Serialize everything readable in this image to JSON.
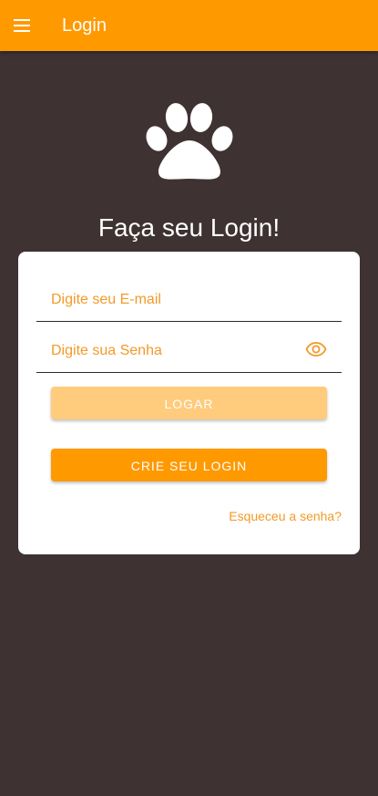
{
  "appbar": {
    "title": "Login",
    "menu_icon": "menu-icon",
    "background": "#ff9900"
  },
  "logo": {
    "icon": "paw-icon"
  },
  "main": {
    "title": "Faça seu Login!"
  },
  "form": {
    "email_placeholder": "Digite seu E-mail",
    "email_value": "",
    "password_placeholder": "Digite sua Senha",
    "password_value": "",
    "password_toggle_icon": "eye-icon",
    "login_label": "LOGAR",
    "create_label": "CRIE SEU LOGIN",
    "forgot_label": "Esqueceu a senha?"
  },
  "colors": {
    "accent": "#ff9900",
    "accent_light": "#ffcb7c",
    "placeholder": "#f29a28",
    "background": "#3e3232",
    "card": "#ffffff"
  }
}
